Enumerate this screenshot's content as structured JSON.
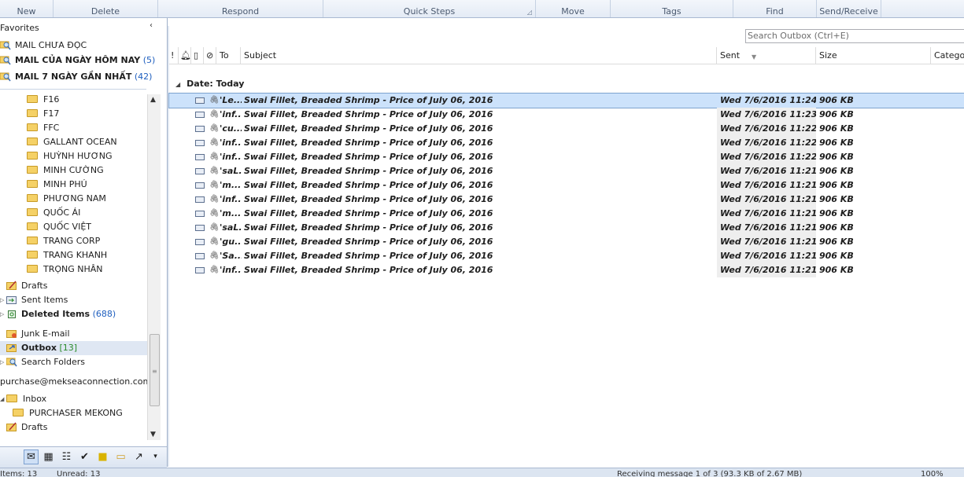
{
  "ribbon": {
    "groups": [
      "New",
      "Delete",
      "Respond",
      "Quick Steps",
      "Move",
      "Tags",
      "Find",
      "Send/Receive"
    ]
  },
  "nav": {
    "favorites_header": "Favorites",
    "favorites": [
      {
        "label": "MAIL CHƯA ĐỌC",
        "count": "",
        "bold": false
      },
      {
        "label": "MAIL CỦA NGÀY HÔM NAY",
        "count": "(5)",
        "bold": true
      },
      {
        "label": "MAIL 7 NGÀY GẦN NHẤT",
        "count": "(42)",
        "bold": true
      }
    ],
    "folders": [
      "F16",
      "F17",
      "FFC",
      "GALLANT OCEAN",
      "HUỲNH HƯƠNG",
      "MINH CƯỜNG",
      "MINH PHÚ",
      "PHƯƠNG NAM",
      "QUỐC ÁI",
      "QUỐC VIỆT",
      "TRANG CORP",
      "TRANG KHANH",
      "TRỌNG NHÂN"
    ],
    "drafts": "Drafts",
    "sent_items": "Sent Items",
    "deleted_items": "Deleted Items",
    "deleted_count": "(688)",
    "junk": "Junk E-mail",
    "outbox": "Outbox",
    "outbox_count": "[13]",
    "search_folders": "Search Folders",
    "account": "purchase@mekseaconnection.com",
    "inbox": "Inbox",
    "purchaser": "PURCHASER MEKONG",
    "drafts2": "Drafts"
  },
  "main": {
    "search_placeholder": "Search Outbox (Ctrl+E)",
    "columns": {
      "to": "To",
      "subject": "Subject",
      "sent": "Sent",
      "size": "Size",
      "categories": "Catego"
    },
    "group_label": "Date: Today",
    "rows": [
      {
        "to": "'Le...",
        "subject": "Swai Fillet, Breaded Shrimp - Price of July 06, 2016",
        "sent": "Wed 7/6/2016 11:24 ...",
        "size": "906 KB",
        "selected": true
      },
      {
        "to": "'inf...",
        "subject": "Swai Fillet, Breaded Shrimp - Price of July 06, 2016",
        "sent": "Wed 7/6/2016 11:23 ...",
        "size": "906 KB"
      },
      {
        "to": "'cu...",
        "subject": "Swai Fillet, Breaded Shrimp - Price of July 06, 2016",
        "sent": "Wed 7/6/2016 11:22 ...",
        "size": "906 KB"
      },
      {
        "to": "'inf...",
        "subject": "Swai Fillet, Breaded Shrimp - Price of July 06, 2016",
        "sent": "Wed 7/6/2016 11:22 ...",
        "size": "906 KB"
      },
      {
        "to": "'inf...",
        "subject": "Swai Fillet, Breaded Shrimp - Price of July 06, 2016",
        "sent": "Wed 7/6/2016 11:22 ...",
        "size": "906 KB"
      },
      {
        "to": "'saL...",
        "subject": "Swai Fillet, Breaded Shrimp - Price of July 06, 2016",
        "sent": "Wed 7/6/2016 11:21 ...",
        "size": "906 KB"
      },
      {
        "to": "'m...",
        "subject": "Swai Fillet, Breaded Shrimp - Price of July 06, 2016",
        "sent": "Wed 7/6/2016 11:21 ...",
        "size": "906 KB"
      },
      {
        "to": "'inf...",
        "subject": "Swai Fillet, Breaded Shrimp - Price of July 06, 2016",
        "sent": "Wed 7/6/2016 11:21 ...",
        "size": "906 KB"
      },
      {
        "to": "'m...",
        "subject": "Swai Fillet, Breaded Shrimp - Price of July 06, 2016",
        "sent": "Wed 7/6/2016 11:21 ...",
        "size": "906 KB"
      },
      {
        "to": "'saL...",
        "subject": "Swai Fillet, Breaded Shrimp - Price of July 06, 2016",
        "sent": "Wed 7/6/2016 11:21 ...",
        "size": "906 KB"
      },
      {
        "to": "'gu...",
        "subject": "Swai Fillet, Breaded Shrimp - Price of July 06, 2016",
        "sent": "Wed 7/6/2016 11:21 ...",
        "size": "906 KB"
      },
      {
        "to": "'Sa...",
        "subject": "Swai Fillet, Breaded Shrimp - Price of July 06, 2016",
        "sent": "Wed 7/6/2016 11:21 ...",
        "size": "906 KB"
      },
      {
        "to": "'inf...",
        "subject": "Swai Fillet, Breaded Shrimp - Price of July 06, 2016",
        "sent": "Wed 7/6/2016 11:21 ...",
        "size": "906 KB"
      }
    ]
  },
  "status": {
    "items": "Items: 13",
    "unread": "Unread: 13",
    "receiving": "Receiving message 1 of 3 (93.3 KB of 2.67 MB)",
    "zoom": "100%"
  }
}
